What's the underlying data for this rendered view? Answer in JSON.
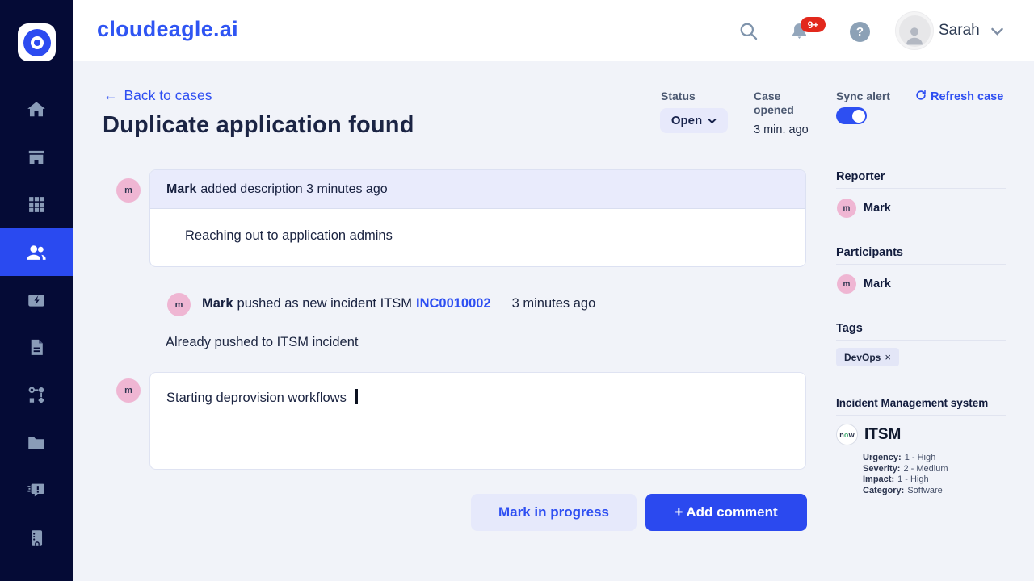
{
  "colors": {
    "accent_blue": "#2d4ff2",
    "brand_blue": "#2f55f3",
    "sidebar_navy": "#050b36",
    "active_nav_blue": "#2a4af0",
    "badge_red": "#e2281c",
    "avatar_pink": "#efb6d3",
    "servicenow_green": "#4db37a",
    "content_bg": "#f1f3f9"
  },
  "header": {
    "brand": "cloudeagle.ai",
    "notification_badge": "9+",
    "user_name": "Sarah"
  },
  "sidebar": {
    "items": [
      {
        "icon": "home-icon",
        "active": false
      },
      {
        "icon": "storefront-icon",
        "active": false
      },
      {
        "icon": "apps-grid-icon",
        "active": false
      },
      {
        "icon": "users-icon",
        "active": true
      },
      {
        "icon": "card-bolt-icon",
        "active": false
      },
      {
        "icon": "document-icon",
        "active": false
      },
      {
        "icon": "workflow-icon",
        "active": false
      },
      {
        "icon": "folder-icon",
        "active": false
      },
      {
        "icon": "chat-alert-icon",
        "active": false
      },
      {
        "icon": "kiosk-icon",
        "active": false
      }
    ]
  },
  "case": {
    "back_link": "Back to cases",
    "title": "Duplicate application found",
    "status_label": "Status",
    "status_value": "Open",
    "case_opened_label": "Case opened",
    "case_opened_value": "3 min. ago",
    "sync_alert_label": "Sync alert",
    "sync_alert_on": true,
    "refresh_label": "Refresh case",
    "timeline": [
      {
        "avatar": "m",
        "user": "Mark",
        "header_text": "added description 3 minutes ago",
        "body": "Reaching out to application admins"
      },
      {
        "avatar": "m",
        "user": "Mark",
        "action": "pushed as new incident ITSM",
        "link": "INC0010002",
        "time": "3 minutes ago",
        "note": "Already pushed to ITSM incident"
      }
    ],
    "comment_input": {
      "avatar": "m",
      "value": "Starting deprovision workflows"
    },
    "buttons": {
      "mark_in_progress": "Mark in progress",
      "add_comment": "+ Add comment"
    }
  },
  "details_panel": {
    "reporter": {
      "heading": "Reporter",
      "avatar": "m",
      "name": "Mark"
    },
    "participants": {
      "heading": "Participants",
      "avatar": "m",
      "name": "Mark"
    },
    "tags": {
      "heading": "Tags",
      "tag": {
        "label": "DevOps",
        "remove_symbol": "×"
      }
    },
    "incident": {
      "heading": "Incident Management system",
      "logo_n": "n",
      "logo_o": "o",
      "logo_w": "w",
      "system_name": "ITSM",
      "fields": [
        {
          "label": "Urgency:",
          "value": "1 - High"
        },
        {
          "label": "Severity:",
          "value": "2 - Medium"
        },
        {
          "label": "Impact:",
          "value": "1 - High"
        },
        {
          "label": "Category:",
          "value": "Software"
        }
      ]
    }
  }
}
